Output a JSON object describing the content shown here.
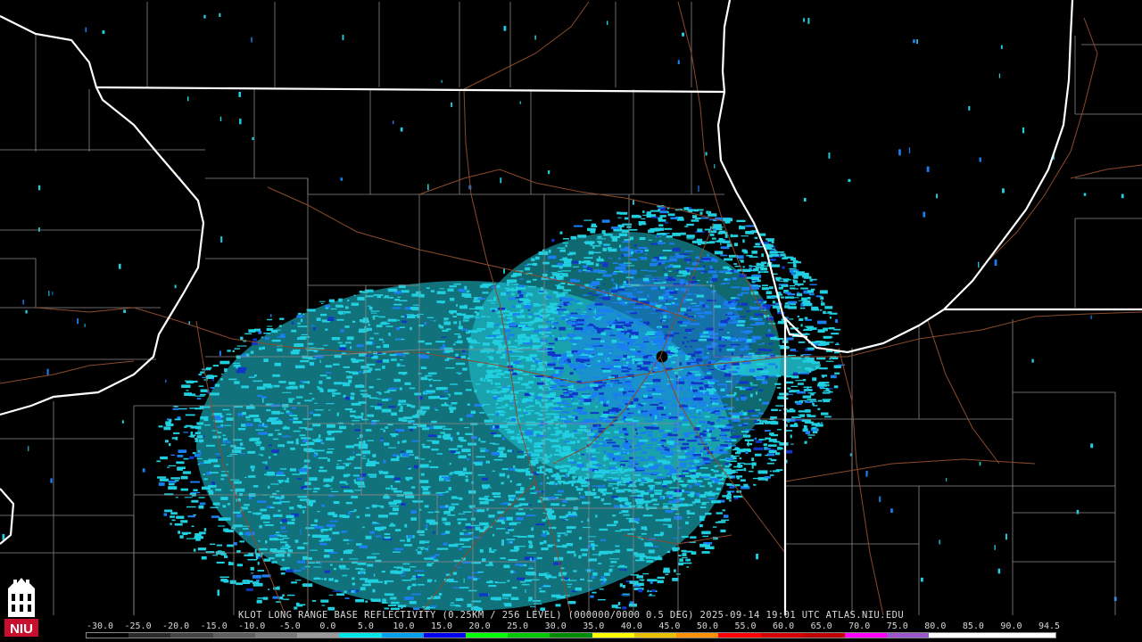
{
  "caption": "KLOT LONG RANGE BASE REFLECTIVITY (0.25KM / 256 LEVEL) (000000/0000 0.5 DEG) 2025-09-14 19:01 UTC  ATLAS.NIU.EDU",
  "logo_text": "NIU",
  "scale": {
    "labels": [
      "-30.0",
      "-25.0",
      "-20.0",
      "-15.0",
      "-10.0",
      "-5.0",
      "0.0",
      "5.0",
      "10.0",
      "15.0",
      "20.0",
      "25.0",
      "30.0",
      "35.0",
      "40.0",
      "45.0",
      "50.0",
      "55.0",
      "60.0",
      "65.0",
      "70.0",
      "75.0",
      "80.0",
      "85.0",
      "90.0",
      "94.5"
    ],
    "colors": [
      "#000000",
      "#2a2a2a",
      "#444444",
      "#5e5e5e",
      "#787878",
      "#9a9a9a",
      "#00e6e6",
      "#00a0f0",
      "#0000f0",
      "#00ff00",
      "#00c800",
      "#008c00",
      "#ffff00",
      "#e7c000",
      "#ff9000",
      "#ff0000",
      "#d60000",
      "#c00000",
      "#ff00ff",
      "#9955c9",
      "#ffffff",
      "#ffffff",
      "#ffffff"
    ]
  },
  "map": {
    "radar_site": "KLOT",
    "colors": {
      "state_border": "#ffffff",
      "county_line": "#8a8a8a",
      "highway": "#8b4a2b",
      "echo_light": "#20d0e0",
      "echo_mid": "#1a7ff0",
      "echo_dark": "#1036c8"
    }
  }
}
